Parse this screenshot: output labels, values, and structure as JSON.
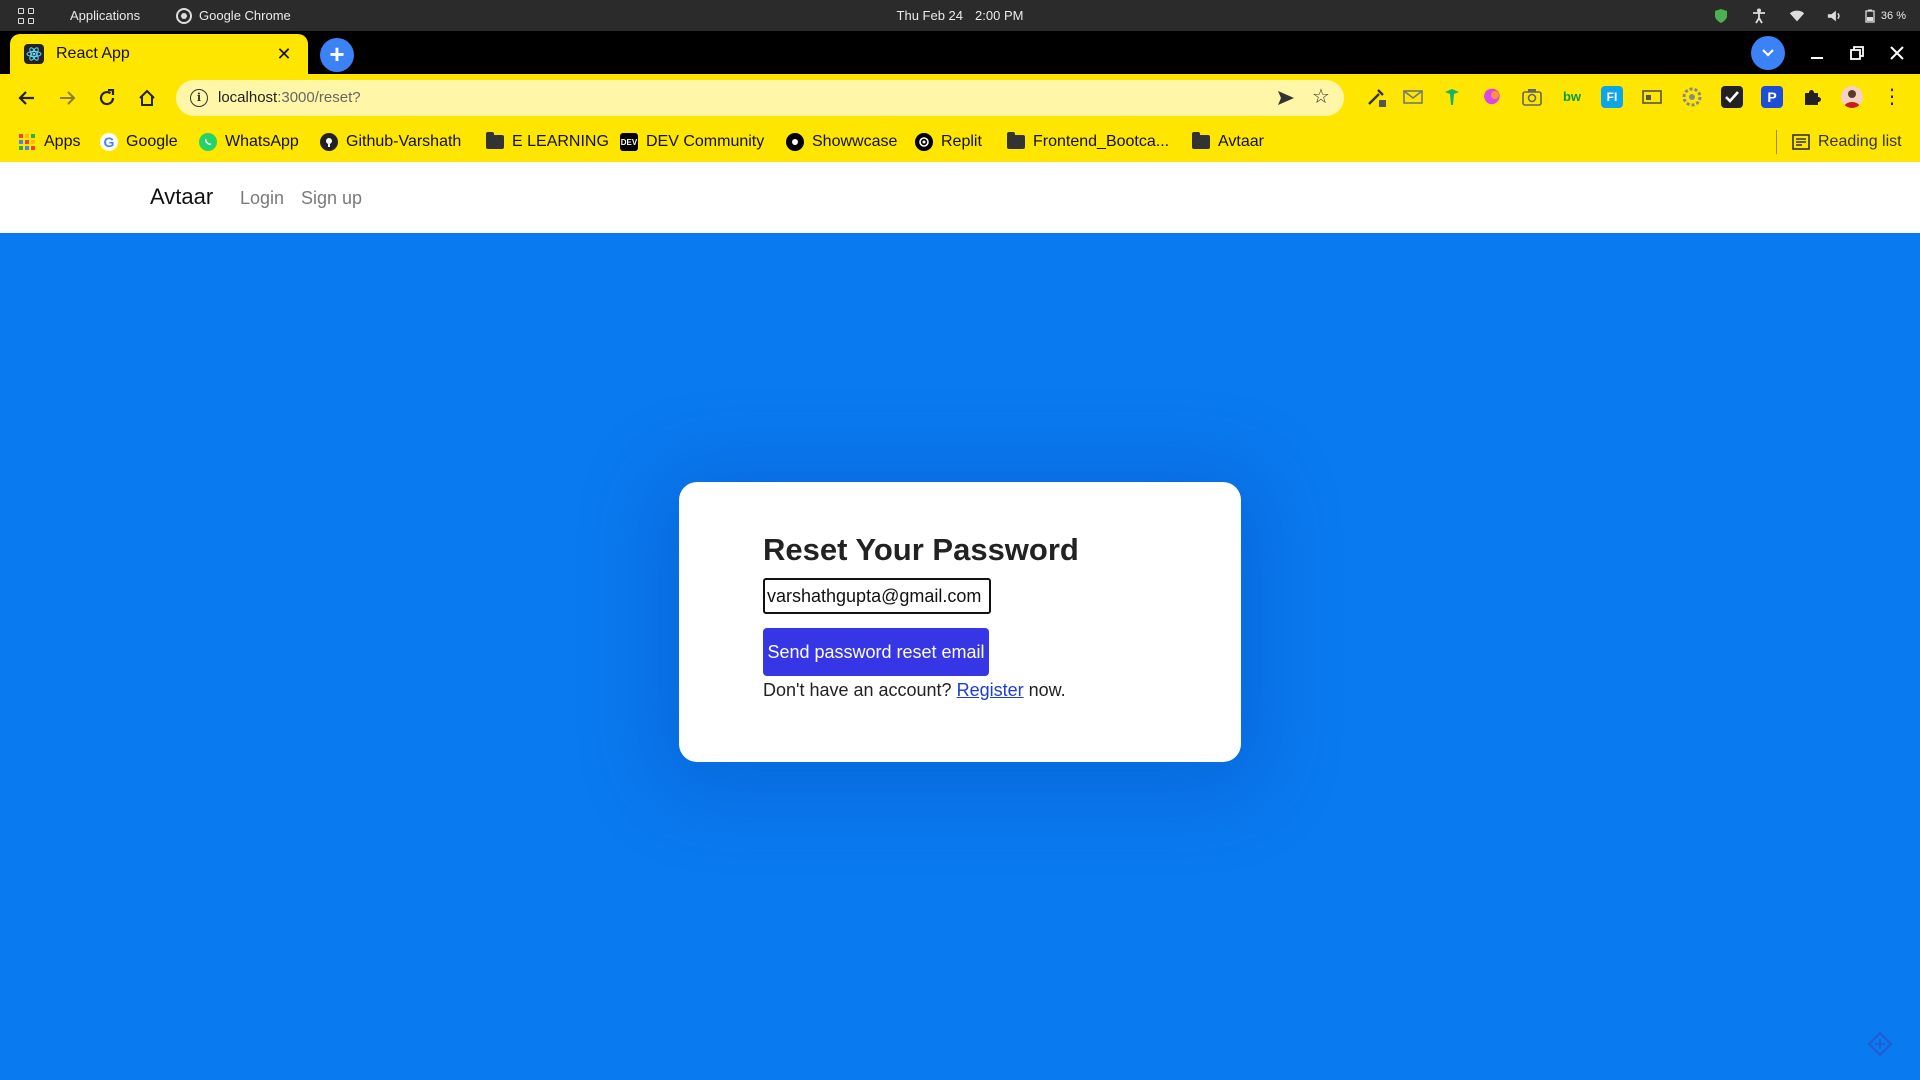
{
  "os_bar": {
    "applications_label": "Applications",
    "active_app_label": "Google Chrome",
    "date": "Thu Feb 24",
    "time": "2:00 PM",
    "battery": "36 %"
  },
  "browser": {
    "tab_title": "React App",
    "url_host": "localhost",
    "url_path": ":3000/reset?",
    "bookmarks": [
      {
        "label": "Apps"
      },
      {
        "label": "Google"
      },
      {
        "label": "WhatsApp"
      },
      {
        "label": "Github-Varshath"
      },
      {
        "label": "E LEARNING"
      },
      {
        "label": "DEV Community"
      },
      {
        "label": "Showwcase"
      },
      {
        "label": "Replit"
      },
      {
        "label": "Frontend_Bootca..."
      },
      {
        "label": "Avtaar"
      }
    ],
    "reading_list_label": "Reading list"
  },
  "site": {
    "brand": "Avtaar",
    "nav": {
      "login": "Login",
      "signup": "Sign up"
    }
  },
  "reset_form": {
    "title": "Reset Your Password",
    "email_value": "varshathgupta@gmail.com",
    "submit_label": "Send password reset email",
    "no_account_text": "Don't have an account?",
    "register_link": "Register",
    "now_text": "now."
  },
  "colors": {
    "page_background": "#0a7af0",
    "chrome_accent": "#ffe600",
    "submit_button": "#3636e6"
  }
}
